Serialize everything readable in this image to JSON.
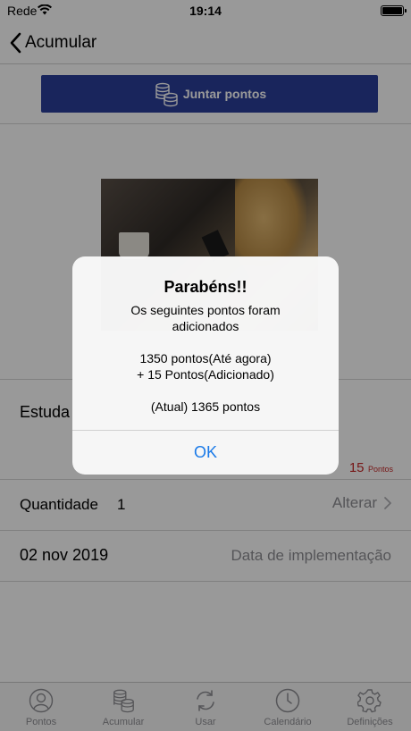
{
  "status_bar": {
    "carrier": "Rede",
    "time": "19:14"
  },
  "nav": {
    "back_label": "Acumular"
  },
  "join_button": {
    "label": "Juntar pontos"
  },
  "item": {
    "name": "Estuda",
    "points_value": "15",
    "points_unit": "Pontos"
  },
  "quantity": {
    "label": "Quantidade",
    "value": "1",
    "action": "Alterar"
  },
  "date_row": {
    "date": "02 nov 2019",
    "label": "Data de implementação"
  },
  "tabs": [
    {
      "label": "Pontos",
      "icon": "person-circle-icon"
    },
    {
      "label": "Acumular",
      "icon": "coins-icon"
    },
    {
      "label": "Usar",
      "icon": "refresh-icon"
    },
    {
      "label": "Calendário",
      "icon": "clock-icon"
    },
    {
      "label": "Definições",
      "icon": "gear-icon"
    }
  ],
  "alert": {
    "title": "Parabéns!!",
    "line1": "Os seguintes pontos foram",
    "line2": "adicionados",
    "line3": "1350 pontos(Até agora)",
    "line4": "+ 15 Pontos(Adicionado)",
    "line5": "(Atual) 1365 pontos",
    "ok_label": "OK"
  },
  "colors": {
    "button_bg": "#2b3f99",
    "points_red": "#c62828",
    "link_blue": "#1a7ae8",
    "secondary_gray": "#8e8e93"
  }
}
